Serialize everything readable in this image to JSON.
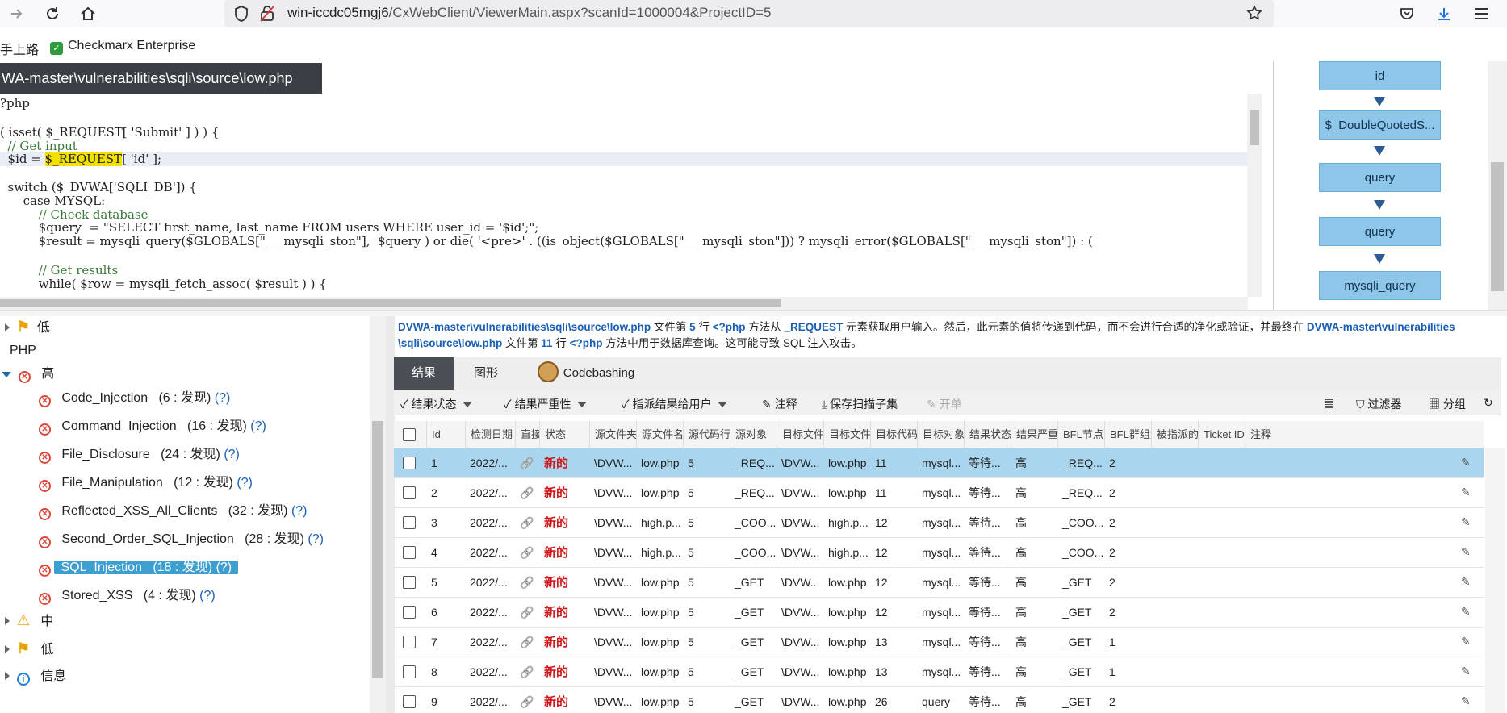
{
  "browser": {
    "url_host": "win-iccdc05mgj6",
    "url_path": "/CxWebClient/ViewerMain.aspx?scanId=1000004&ProjectID=5",
    "bookmarks": [
      {
        "label": "手上路"
      },
      {
        "label": "Checkmarx Enterprise"
      }
    ]
  },
  "code_viewer": {
    "file_tab": "WA-master\\vulnerabilities\\sqli\\source\\low.php",
    "lines": [
      "?php",
      "",
      "( isset( $_REQUEST[ 'Submit' ] ) ) {",
      "  // Get input",
      "  $id = ",
      "",
      "  switch ($_DVWA['SQLI_DB']) {",
      "      case MYSQL:",
      "          // Check database",
      "          $query  = \"SELECT first_name, last_name FROM users WHERE user_id = '$id';\";",
      "          $result = mysqli_query($GLOBALS[\"___mysqli_ston\"],  $query ) or die( '<pre>' . ((is_object($GLOBALS[\"___mysqli_ston\"])) ? mysqli_error($GLOBALS[\"___mysqli_ston\"]) : (",
      "",
      "          // Get results",
      "          while( $row = mysqli_fetch_assoc( $result ) ) {"
    ],
    "highlight_token": "$_REQUEST",
    "highlight_rest": "[ 'id' ];"
  },
  "graph_nodes": [
    "id",
    "$_DoubleQuotedS...",
    "query",
    "query",
    "mysqli_query"
  ],
  "tree": {
    "low_top": "低",
    "php": "PHP",
    "high": "高",
    "items": [
      {
        "name": "Code_Injection",
        "count": "(6 : 发现)",
        "help": "(?)"
      },
      {
        "name": "Command_Injection",
        "count": "(16 : 发现)",
        "help": "(?)"
      },
      {
        "name": "File_Disclosure",
        "count": "(24 : 发现)",
        "help": "(?)"
      },
      {
        "name": "File_Manipulation",
        "count": "(12 : 发现)",
        "help": "(?)"
      },
      {
        "name": "Reflected_XSS_All_Clients",
        "count": "(32 : 发现)",
        "help": "(?)"
      },
      {
        "name": "Second_Order_SQL_Injection",
        "count": "(28 : 发现)",
        "help": "(?)"
      },
      {
        "name": "SQL_Injection",
        "count": "(18 : 发现)",
        "help": "(?)"
      },
      {
        "name": "Stored_XSS",
        "count": "(4 : 发现)",
        "help": "(?)"
      }
    ],
    "medium": "中",
    "low": "低",
    "info": "信息"
  },
  "description": {
    "p1": "DVWA-master\\vulnerabilities\\sqli\\source\\low.php",
    "t1": " 文件第 ",
    "n1": "5",
    "t2": " 行 ",
    "m1": "<?php",
    "t3": " 方法从 ",
    "r1": "_REQUEST",
    "t4": " 元素获取用户输入。然后，此元素的值将传递到代码，而不会进行合适的净化或验证，并最终在 ",
    "p2a": "DVWA-master\\vulnerabilities",
    "p2b": "\\sqli\\source\\low.php",
    "t5": " 文件第 ",
    "n2": "11",
    "t6": " 行 ",
    "m2": "<?php",
    "t7": " 方法中用于数据库查询。这可能导致 SQL 注入攻击。"
  },
  "tabs": [
    "结果",
    "图形",
    "Codebashing"
  ],
  "actions": {
    "status": "结果状态",
    "severity": "结果严重性",
    "assign": "指派结果给用户",
    "comment": "注释",
    "save_subset": "保存扫描子集",
    "open_ticket": "开单",
    "filter": "过滤器",
    "group": "分组"
  },
  "columns": [
    "Id",
    "检测日期",
    "直接链",
    "状态",
    "源文件夹",
    "源文件名",
    "源代码行",
    "源对象",
    "目标文件夹",
    "目标文件名",
    "目标代码行",
    "目标对象",
    "结果状态",
    "结果严重性",
    "BFL节点",
    "BFL群组大小",
    "被指派的用户",
    "Ticket ID",
    "注释"
  ],
  "rows": [
    {
      "id": "1",
      "date": "2022/...",
      "status": "新的",
      "src_folder": "\\DVW...",
      "src_file": "low.php",
      "src_line": "5",
      "src_obj": "_REQ...",
      "dst_folder": "\\DVW...",
      "dst_file": "low.php",
      "dst_line": "11",
      "dst_obj": "mysql...",
      "res_status": "等待...",
      "severity": "高",
      "bfl": "_REQ...",
      "bfl_size": "2"
    },
    {
      "id": "2",
      "date": "2022/...",
      "status": "新的",
      "src_folder": "\\DVW...",
      "src_file": "low.php",
      "src_line": "5",
      "src_obj": "_REQ...",
      "dst_folder": "\\DVW...",
      "dst_file": "low.php",
      "dst_line": "11",
      "dst_obj": "mysql...",
      "res_status": "等待...",
      "severity": "高",
      "bfl": "_REQ...",
      "bfl_size": "2"
    },
    {
      "id": "3",
      "date": "2022/...",
      "status": "新的",
      "src_folder": "\\DVW...",
      "src_file": "high.p...",
      "src_line": "5",
      "src_obj": "_COO...",
      "dst_folder": "\\DVW...",
      "dst_file": "high.p...",
      "dst_line": "12",
      "dst_obj": "mysql...",
      "res_status": "等待...",
      "severity": "高",
      "bfl": "_COO...",
      "bfl_size": "2"
    },
    {
      "id": "4",
      "date": "2022/...",
      "status": "新的",
      "src_folder": "\\DVW...",
      "src_file": "high.p...",
      "src_line": "5",
      "src_obj": "_COO...",
      "dst_folder": "\\DVW...",
      "dst_file": "high.p...",
      "dst_line": "12",
      "dst_obj": "mysql...",
      "res_status": "等待...",
      "severity": "高",
      "bfl": "_COO...",
      "bfl_size": "2"
    },
    {
      "id": "5",
      "date": "2022/...",
      "status": "新的",
      "src_folder": "\\DVW...",
      "src_file": "low.php",
      "src_line": "5",
      "src_obj": "_GET",
      "dst_folder": "\\DVW...",
      "dst_file": "low.php",
      "dst_line": "12",
      "dst_obj": "mysql...",
      "res_status": "等待...",
      "severity": "高",
      "bfl": "_GET",
      "bfl_size": "2"
    },
    {
      "id": "6",
      "date": "2022/...",
      "status": "新的",
      "src_folder": "\\DVW...",
      "src_file": "low.php",
      "src_line": "5",
      "src_obj": "_GET",
      "dst_folder": "\\DVW...",
      "dst_file": "low.php",
      "dst_line": "12",
      "dst_obj": "mysql...",
      "res_status": "等待...",
      "severity": "高",
      "bfl": "_GET",
      "bfl_size": "2"
    },
    {
      "id": "7",
      "date": "2022/...",
      "status": "新的",
      "src_folder": "\\DVW...",
      "src_file": "low.php",
      "src_line": "5",
      "src_obj": "_GET",
      "dst_folder": "\\DVW...",
      "dst_file": "low.php",
      "dst_line": "13",
      "dst_obj": "mysql...",
      "res_status": "等待...",
      "severity": "高",
      "bfl": "_GET",
      "bfl_size": "1"
    },
    {
      "id": "8",
      "date": "2022/...",
      "status": "新的",
      "src_folder": "\\DVW...",
      "src_file": "low.php",
      "src_line": "5",
      "src_obj": "_GET",
      "dst_folder": "\\DVW...",
      "dst_file": "low.php",
      "dst_line": "13",
      "dst_obj": "mysql...",
      "res_status": "等待...",
      "severity": "高",
      "bfl": "_GET",
      "bfl_size": "1"
    },
    {
      "id": "9",
      "date": "2022/...",
      "status": "新的",
      "src_folder": "\\DVW...",
      "src_file": "low.php",
      "src_line": "5",
      "src_obj": "_GET",
      "dst_folder": "\\DVW...",
      "dst_file": "low.php",
      "dst_line": "26",
      "dst_obj": "query",
      "res_status": "等待...",
      "severity": "高",
      "bfl": "_GET",
      "bfl_size": "2"
    }
  ],
  "colors": {
    "selected_row": "#a9d6ee",
    "new_status": "#d0181a",
    "graph_node": "#8ec6ea",
    "tab_active": "#4a4f55"
  }
}
